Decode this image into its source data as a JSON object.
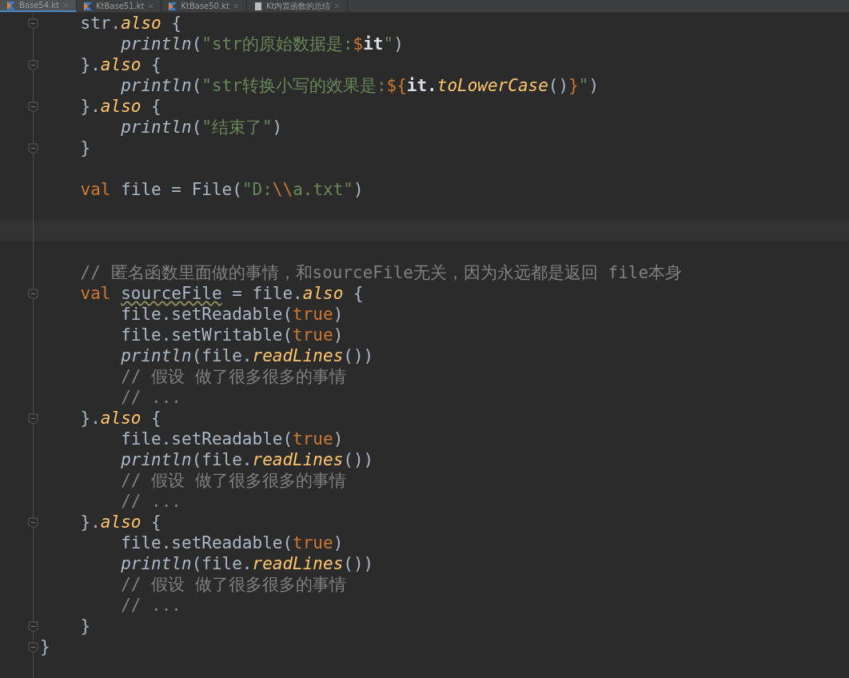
{
  "tabs": [
    {
      "label": "Base54.kt",
      "selected": true,
      "kind": "kotlin"
    },
    {
      "label": "KtBase51.kt",
      "selected": false,
      "kind": "kotlin"
    },
    {
      "label": "KtBase50.kt",
      "selected": false,
      "kind": "kotlin"
    },
    {
      "label": "Kt内置函数的总结",
      "selected": false,
      "kind": "text"
    }
  ],
  "lines": [
    {
      "kind": "code",
      "fold": true,
      "tokens": [
        {
          "kind": "text",
          "text": "    str."
        },
        {
          "kind": "ext",
          "text": "also"
        },
        {
          "kind": "text",
          "text": " {"
        }
      ]
    },
    {
      "kind": "code",
      "fold": false,
      "tokens": [
        {
          "kind": "call",
          "text": "        println"
        },
        {
          "kind": "text",
          "text": "("
        },
        {
          "kind": "string",
          "text": "\"str的原始数据是:"
        },
        {
          "kind": "template",
          "text": "$"
        },
        {
          "kind": "ref",
          "text": "it"
        },
        {
          "kind": "string",
          "text": "\""
        },
        {
          "kind": "text",
          "text": ")"
        }
      ]
    },
    {
      "kind": "code",
      "fold": true,
      "tokens": [
        {
          "kind": "text",
          "text": "    }."
        },
        {
          "kind": "ext",
          "text": "also"
        },
        {
          "kind": "text",
          "text": " {"
        }
      ]
    },
    {
      "kind": "code",
      "fold": false,
      "tokens": [
        {
          "kind": "call",
          "text": "        println"
        },
        {
          "kind": "text",
          "text": "("
        },
        {
          "kind": "string",
          "text": "\"str转换小写的效果是:"
        },
        {
          "kind": "template",
          "text": "${"
        },
        {
          "kind": "ref",
          "text": "it."
        },
        {
          "kind": "ext",
          "text": "toLowerCase"
        },
        {
          "kind": "text",
          "text": "()"
        },
        {
          "kind": "template",
          "text": "}"
        },
        {
          "kind": "string",
          "text": "\""
        },
        {
          "kind": "text",
          "text": ")"
        }
      ]
    },
    {
      "kind": "code",
      "fold": true,
      "tokens": [
        {
          "kind": "text",
          "text": "    }."
        },
        {
          "kind": "ext",
          "text": "also"
        },
        {
          "kind": "text",
          "text": " {"
        }
      ]
    },
    {
      "kind": "code",
      "fold": false,
      "tokens": [
        {
          "kind": "call",
          "text": "        println"
        },
        {
          "kind": "text",
          "text": "("
        },
        {
          "kind": "string",
          "text": "\"结束了\""
        },
        {
          "kind": "text",
          "text": ")"
        }
      ]
    },
    {
      "kind": "code",
      "fold": true,
      "tokens": [
        {
          "kind": "text",
          "text": "    }"
        }
      ]
    },
    {
      "kind": "blank"
    },
    {
      "kind": "code",
      "fold": false,
      "tokens": [
        {
          "kind": "keyword",
          "text": "    val"
        },
        {
          "kind": "text",
          "text": " file = File("
        },
        {
          "kind": "string",
          "text": "\"D:"
        },
        {
          "kind": "template",
          "text": "\\\\"
        },
        {
          "kind": "string",
          "text": "a.txt\""
        },
        {
          "kind": "text",
          "text": ")"
        }
      ]
    },
    {
      "kind": "blank"
    },
    {
      "kind": "caret"
    },
    {
      "kind": "blank"
    },
    {
      "kind": "code",
      "fold": false,
      "tokens": [
        {
          "kind": "comment",
          "text": "    // 匿名函数里面做的事情，和sourceFile无关，因为永远都是返回 file本身"
        }
      ]
    },
    {
      "kind": "code",
      "fold": true,
      "tokens": [
        {
          "kind": "keyword",
          "text": "    val "
        },
        {
          "kind": "warn",
          "text": "sourceFile"
        },
        {
          "kind": "text",
          "text": " = file."
        },
        {
          "kind": "ext",
          "text": "also"
        },
        {
          "kind": "text",
          "text": " {"
        }
      ]
    },
    {
      "kind": "code",
      "fold": false,
      "tokens": [
        {
          "kind": "text",
          "text": "        file.setReadable("
        },
        {
          "kind": "keyword",
          "text": "true"
        },
        {
          "kind": "text",
          "text": ")"
        }
      ]
    },
    {
      "kind": "code",
      "fold": false,
      "tokens": [
        {
          "kind": "text",
          "text": "        file.setWritable("
        },
        {
          "kind": "keyword",
          "text": "true"
        },
        {
          "kind": "text",
          "text": ")"
        }
      ]
    },
    {
      "kind": "code",
      "fold": false,
      "tokens": [
        {
          "kind": "call",
          "text": "        println"
        },
        {
          "kind": "text",
          "text": "(file."
        },
        {
          "kind": "ext",
          "text": "readLines"
        },
        {
          "kind": "text",
          "text": "())"
        }
      ]
    },
    {
      "kind": "code",
      "fold": false,
      "tokens": [
        {
          "kind": "comment",
          "text": "        // 假设 做了很多很多的事情"
        }
      ]
    },
    {
      "kind": "code",
      "fold": false,
      "tokens": [
        {
          "kind": "comment",
          "text": "        // ..."
        }
      ]
    },
    {
      "kind": "code",
      "fold": true,
      "tokens": [
        {
          "kind": "text",
          "text": "    }."
        },
        {
          "kind": "ext",
          "text": "also"
        },
        {
          "kind": "text",
          "text": " {"
        }
      ]
    },
    {
      "kind": "code",
      "fold": false,
      "tokens": [
        {
          "kind": "text",
          "text": "        file.setReadable("
        },
        {
          "kind": "keyword",
          "text": "true"
        },
        {
          "kind": "text",
          "text": ")"
        }
      ]
    },
    {
      "kind": "code",
      "fold": false,
      "tokens": [
        {
          "kind": "call",
          "text": "        println"
        },
        {
          "kind": "text",
          "text": "(file."
        },
        {
          "kind": "ext",
          "text": "readLines"
        },
        {
          "kind": "text",
          "text": "())"
        }
      ]
    },
    {
      "kind": "code",
      "fold": false,
      "tokens": [
        {
          "kind": "comment",
          "text": "        // 假设 做了很多很多的事情"
        }
      ]
    },
    {
      "kind": "code",
      "fold": false,
      "tokens": [
        {
          "kind": "comment",
          "text": "        // ..."
        }
      ]
    },
    {
      "kind": "code",
      "fold": true,
      "tokens": [
        {
          "kind": "text",
          "text": "    }."
        },
        {
          "kind": "ext",
          "text": "also"
        },
        {
          "kind": "text",
          "text": " {"
        }
      ]
    },
    {
      "kind": "code",
      "fold": false,
      "tokens": [
        {
          "kind": "text",
          "text": "        file.setReadable("
        },
        {
          "kind": "keyword",
          "text": "true"
        },
        {
          "kind": "text",
          "text": ")"
        }
      ]
    },
    {
      "kind": "code",
      "fold": false,
      "tokens": [
        {
          "kind": "call",
          "text": "        println"
        },
        {
          "kind": "text",
          "text": "(file."
        },
        {
          "kind": "ext",
          "text": "readLines"
        },
        {
          "kind": "text",
          "text": "())"
        }
      ]
    },
    {
      "kind": "code",
      "fold": false,
      "tokens": [
        {
          "kind": "comment",
          "text": "        // 假设 做了很多很多的事情"
        }
      ]
    },
    {
      "kind": "code",
      "fold": false,
      "tokens": [
        {
          "kind": "comment",
          "text": "        // ..."
        }
      ]
    },
    {
      "kind": "code",
      "fold": true,
      "tokens": [
        {
          "kind": "text",
          "text": "    }"
        }
      ]
    },
    {
      "kind": "code",
      "fold": true,
      "tokens": [
        {
          "kind": "text",
          "text": "}"
        }
      ]
    }
  ]
}
